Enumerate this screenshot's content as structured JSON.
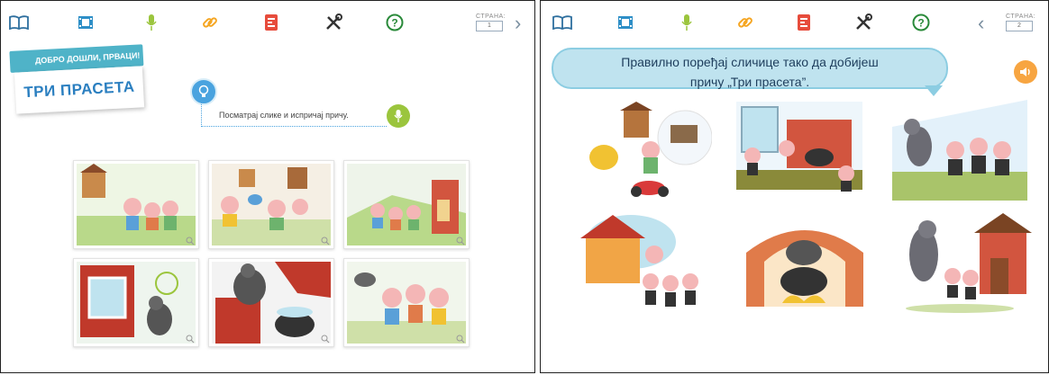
{
  "left_page": {
    "toolbar": {
      "icons": [
        "book-icon",
        "film-icon",
        "microphone-icon",
        "link-icon",
        "document-icon",
        "tools-icon",
        "help-icon"
      ],
      "page_label": "СТРАНА:",
      "page_number": "1",
      "next_arrow": "›"
    },
    "banner": {
      "subtitle": "ДОБРО ДОШЛИ, ПРВАЦИ!",
      "title": "ТРИ ПРАСЕТА"
    },
    "instruction": "Посматрај слике и испричај причу.",
    "colors": {
      "accent": "#4fb3c8",
      "title_blue": "#2b7fc0",
      "mic_green": "#9bc53d"
    }
  },
  "right_page": {
    "toolbar": {
      "icons": [
        "book-icon",
        "film-icon",
        "microphone-icon",
        "link-icon",
        "document-icon",
        "tools-icon",
        "help-icon"
      ],
      "prev_arrow": "‹",
      "page_label": "СТРАНА:",
      "page_number": "2"
    },
    "instruction_line1": "Правилно поређај сличице тако да добијеш",
    "instruction_line2": "причу „Три прасета”.",
    "colors": {
      "bubble": "#bfe3ef",
      "speaker": "#f7a541"
    }
  }
}
